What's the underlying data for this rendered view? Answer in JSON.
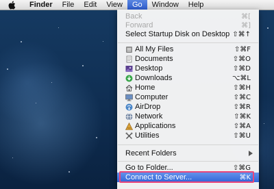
{
  "menubar": {
    "apple_icon": "apple-icon",
    "items": [
      "Finder",
      "File",
      "Edit",
      "View",
      "Go",
      "Window",
      "Help"
    ],
    "active": "Go"
  },
  "go_menu": {
    "back": {
      "label": "Back",
      "shortcut": "⌘["
    },
    "forward": {
      "label": "Forward",
      "shortcut": "⌘]"
    },
    "startup_disk": {
      "label": "Select Startup Disk on Desktop",
      "shortcut": "⇧⌘↑"
    },
    "places": [
      {
        "label": "All My Files",
        "shortcut": "⇧⌘F",
        "icon": "all-my-files-icon"
      },
      {
        "label": "Documents",
        "shortcut": "⇧⌘O",
        "icon": "documents-icon"
      },
      {
        "label": "Desktop",
        "shortcut": "⇧⌘D",
        "icon": "desktop-icon"
      },
      {
        "label": "Downloads",
        "shortcut": "⌥⌘L",
        "icon": "downloads-icon"
      },
      {
        "label": "Home",
        "shortcut": "⇧⌘H",
        "icon": "home-icon"
      },
      {
        "label": "Computer",
        "shortcut": "⇧⌘C",
        "icon": "computer-icon"
      },
      {
        "label": "AirDrop",
        "shortcut": "⇧⌘R",
        "icon": "airdrop-icon"
      },
      {
        "label": "Network",
        "shortcut": "⇧⌘K",
        "icon": "network-icon"
      },
      {
        "label": "Applications",
        "shortcut": "⇧⌘A",
        "icon": "applications-icon"
      },
      {
        "label": "Utilities",
        "shortcut": "⇧⌘U",
        "icon": "utilities-icon"
      }
    ],
    "recent_folders": {
      "label": "Recent Folders"
    },
    "go_to_folder": {
      "label": "Go to Folder...",
      "shortcut": "⇧⌘G"
    },
    "connect_to_server": {
      "label": "Connect to Server...",
      "shortcut": "⌘K"
    }
  },
  "colors": {
    "highlight": "#3a6bdc",
    "callout_border": "#e8457a"
  }
}
